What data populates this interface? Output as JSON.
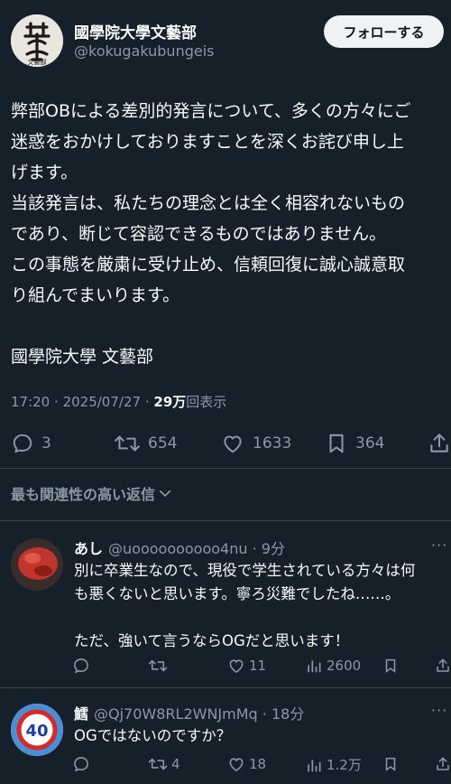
{
  "post": {
    "author_name": "國學院大學文藝部",
    "author_handle": "@kokugakubungeis",
    "avatar_text": "文藝部",
    "follow_label": "フォローする",
    "text": "弊部OBによる差別的発言について、多くの方々にご\n迷惑をおかけしておりますことを深くお詫び申し上\nげます。\n当該発言は、私たちの理念とは全く相容れないもの\nであり、断じて容認できるものではありません。\nこの事態を厳粛に受け止め、信頼回復に誠心誠意取\nり組んでまいります。\n\n國學院大學 文藝部",
    "time": "17:20",
    "date": "2025/07/27",
    "views_count": "29万",
    "views_label": "回表示",
    "separator": "·",
    "replies": "3",
    "reposts": "654",
    "likes": "1633",
    "bookmarks": "364"
  },
  "sort_label": "最も関連性の高い返信",
  "replies": [
    {
      "name": "あし",
      "handle": "@uoooooooooo4nu",
      "time": "9分",
      "text": "別に卒業生なので、現役で学生されている方々は何\nも悪くないと思います。寧ろ災難でしたね……。\n\nただ、強いて言うならOGだと思います！",
      "reposts": "",
      "likes": "11",
      "views": "2600",
      "avatar_color": "#b8322b"
    },
    {
      "name": "鱈",
      "handle": "@Qj70W8RL2WNJmMq",
      "time": "18分",
      "text": "OGではないのですか？",
      "reposts": "4",
      "likes": "18",
      "views": "1.2万",
      "avatar_badge": "40"
    }
  ],
  "colors": {
    "background": "#15202b",
    "text": "#f7f9f9",
    "muted": "#8b98a5",
    "divider": "#38444d",
    "button_bg": "#eff3f4"
  }
}
